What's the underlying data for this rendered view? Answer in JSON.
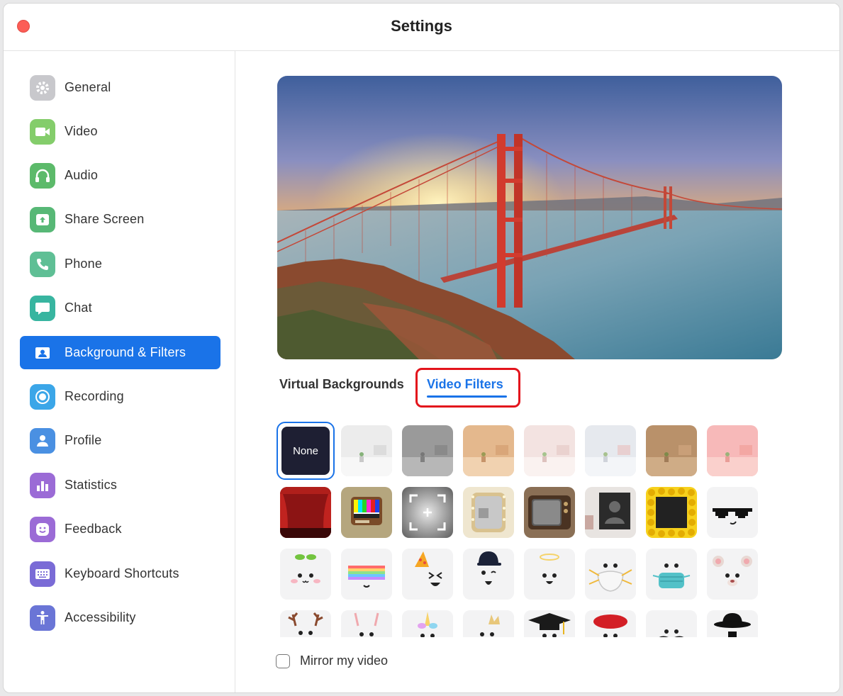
{
  "window": {
    "title": "Settings"
  },
  "sidebar": {
    "items": [
      {
        "label": "General",
        "icon": "gear-icon",
        "color": "#c8c8cc",
        "active": false
      },
      {
        "label": "Video",
        "icon": "video-camera-icon",
        "color": "#84cd6b",
        "active": false
      },
      {
        "label": "Audio",
        "icon": "headphones-icon",
        "color": "#5cba6a",
        "active": false
      },
      {
        "label": "Share Screen",
        "icon": "share-screen-icon",
        "color": "#57b876",
        "active": false
      },
      {
        "label": "Phone",
        "icon": "phone-icon",
        "color": "#5fbf95",
        "active": false
      },
      {
        "label": "Chat",
        "icon": "chat-bubble-icon",
        "color": "#38b5a0",
        "active": false
      },
      {
        "label": "Background & Filters",
        "icon": "person-portrait-icon",
        "color": "#1a73e8",
        "active": true
      },
      {
        "label": "Recording",
        "icon": "record-icon",
        "color": "#3ba6e8",
        "active": false
      },
      {
        "label": "Profile",
        "icon": "profile-icon",
        "color": "#4a90e2",
        "active": false
      },
      {
        "label": "Statistics",
        "icon": "bar-chart-icon",
        "color": "#9b6bd6",
        "active": false
      },
      {
        "label": "Feedback",
        "icon": "smiley-icon",
        "color": "#9b6bd6",
        "active": false
      },
      {
        "label": "Keyboard Shortcuts",
        "icon": "keyboard-icon",
        "color": "#7a6bd6",
        "active": false
      },
      {
        "label": "Accessibility",
        "icon": "accessibility-icon",
        "color": "#6a75d6",
        "active": false
      }
    ]
  },
  "main": {
    "tabs": [
      {
        "label": "Virtual Backgrounds",
        "selected": false
      },
      {
        "label": "Video Filters",
        "selected": true
      }
    ],
    "filters": {
      "none_label": "None",
      "rows": [
        [
          "None",
          "white-room",
          "gray-room",
          "tan-room",
          "light-pink-room",
          "light-blue-room",
          "brown-room",
          "pink-room"
        ],
        [
          "theater-curtain",
          "retro-tv-test-pattern",
          "camera-frame",
          "vanity-mirror",
          "old-tv",
          "picture-frame-room",
          "emoji-frame",
          "pixel-sunglasses"
        ],
        [
          "sprout",
          "rainbow-visor",
          "party-hat",
          "baseball-cap",
          "halo",
          "n95-mask",
          "surgical-mask",
          "bear-ears"
        ],
        [
          "reindeer-antlers",
          "bunny-ears",
          "unicorn-horn",
          "crown",
          "graduation-cap",
          "beret",
          "mustache",
          "fedora"
        ]
      ]
    },
    "mirror_label": "Mirror my video",
    "mirror_checked": false
  },
  "colors": {
    "accent": "#1a73e8",
    "highlight": "#e3141c",
    "close": "#fc5d56"
  }
}
